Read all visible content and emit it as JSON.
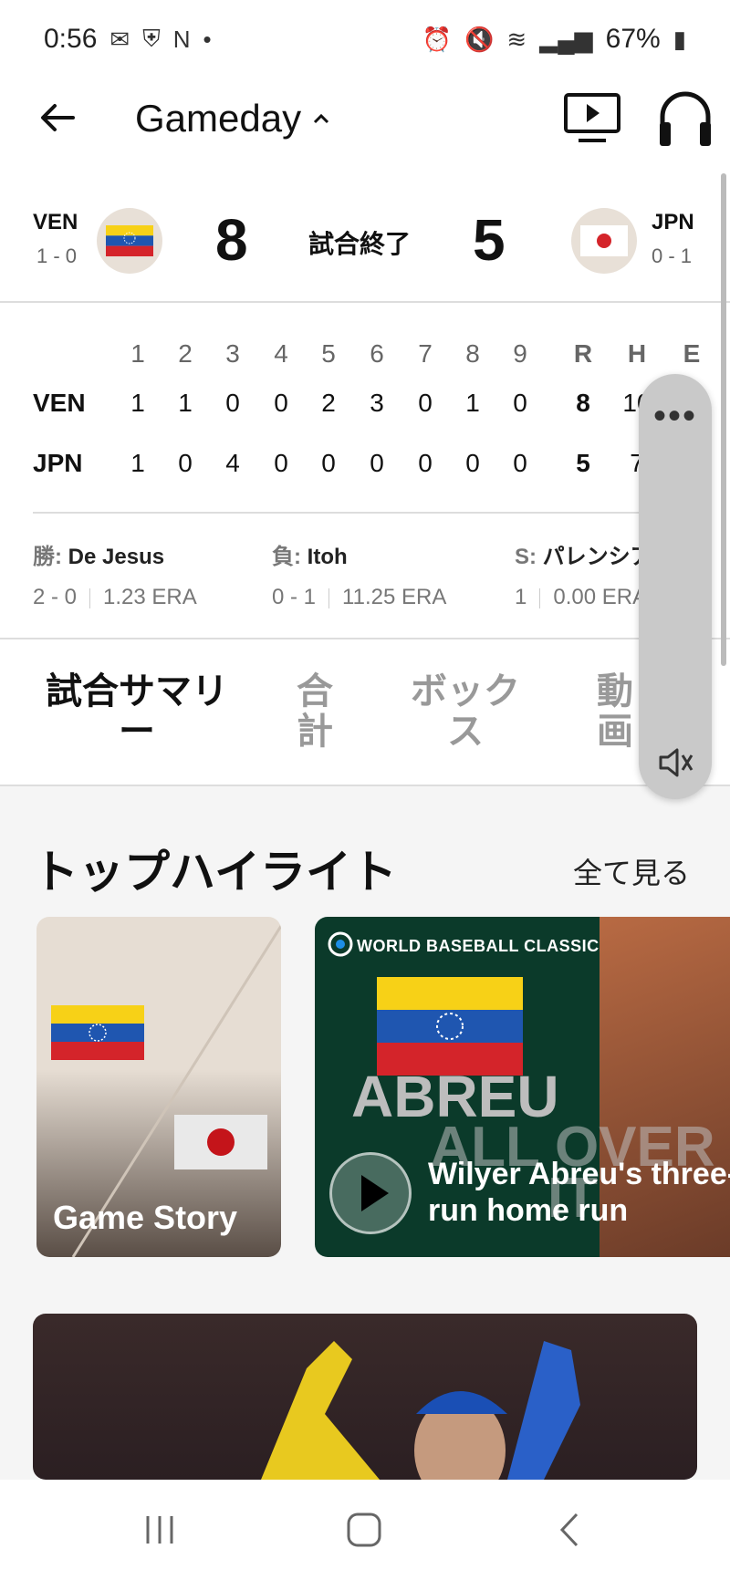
{
  "status_bar": {
    "time": "0:56",
    "battery": "67%"
  },
  "app_bar": {
    "title": "Gameday"
  },
  "game": {
    "away": {
      "abbr": "VEN",
      "record": "1 - 0",
      "score": "8"
    },
    "home": {
      "abbr": "JPN",
      "record": "0 - 1",
      "score": "5"
    },
    "status": "試合終了"
  },
  "linescore": {
    "innings": [
      "1",
      "2",
      "3",
      "4",
      "5",
      "6",
      "7",
      "8",
      "9"
    ],
    "totals_headers": [
      "R",
      "H",
      "E"
    ],
    "rows": [
      {
        "team": "VEN",
        "innings": [
          "1",
          "1",
          "0",
          "0",
          "2",
          "3",
          "0",
          "1",
          "0"
        ],
        "totals": [
          "8",
          "10",
          ""
        ]
      },
      {
        "team": "JPN",
        "innings": [
          "1",
          "0",
          "4",
          "0",
          "0",
          "0",
          "0",
          "0",
          "0"
        ],
        "totals": [
          "5",
          "7",
          ""
        ]
      }
    ]
  },
  "pitchers": [
    {
      "role": "勝:",
      "name": "De Jesus",
      "record": "2 - 0",
      "era": "1.23 ERA"
    },
    {
      "role": "負:",
      "name": "Itoh",
      "record": "0 - 1",
      "era": "11.25 ERA"
    },
    {
      "role": "S:",
      "name": "パレンシア",
      "record": "1",
      "era": "0.00 ERA"
    }
  ],
  "tabs": [
    {
      "label": "試合サマリー"
    },
    {
      "label": "合計"
    },
    {
      "label": "ボックス"
    },
    {
      "label": "動画"
    }
  ],
  "highlights": {
    "title": "トップハイライト",
    "see_all": "全て見る",
    "cards": [
      {
        "title": "Game Story"
      },
      {
        "brand": "WORLD BASEBALL CLASSIC",
        "overlay_big": "ABREU",
        "overlay_sub": "ALL OVER IT",
        "title_line1": "Wilyer Abreu's three-",
        "title_line2": "run home run"
      }
    ]
  }
}
